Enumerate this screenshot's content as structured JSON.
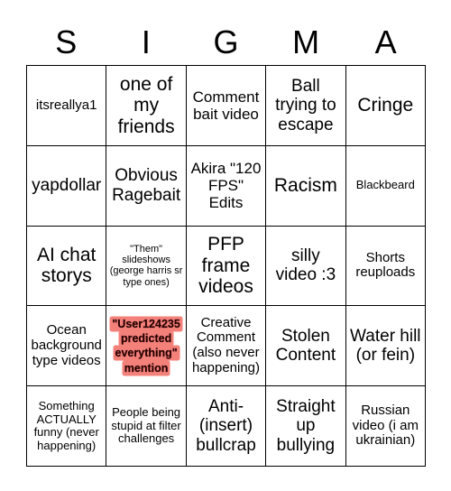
{
  "card": {
    "title": "SIGMA",
    "header_letters": [
      "S",
      "I",
      "G",
      "M",
      "A"
    ],
    "colors": {
      "grid_line": "#000000",
      "text": "#000000",
      "background": "#ffffff",
      "marked_highlight": "#f4807a",
      "marked_text": "#2a0000"
    },
    "rows": [
      [
        {
          "text": "itsreallya1",
          "size": "md",
          "marked": false
        },
        {
          "text": "one of my friends",
          "size": "xxl",
          "marked": false
        },
        {
          "text": "Comment bait video",
          "size": "lg",
          "marked": false
        },
        {
          "text": "Ball trying to escape",
          "size": "xl",
          "marked": false
        },
        {
          "text": "Cringe",
          "size": "xxl",
          "marked": false
        }
      ],
      [
        {
          "text": "yapdollar",
          "size": "xl",
          "marked": false
        },
        {
          "text": "Obvious Ragebait",
          "size": "xl",
          "marked": false
        },
        {
          "text": "Akira \"120 FPS\" Edits",
          "size": "lg",
          "marked": false
        },
        {
          "text": "Racism",
          "size": "xxl",
          "marked": false
        },
        {
          "text": "Blackbeard",
          "size": "sm",
          "marked": false
        }
      ],
      [
        {
          "text": "AI chat storys",
          "size": "xxl",
          "marked": false
        },
        {
          "text": "\"Them\" slideshows (george harris sr type ones)",
          "size": "xs",
          "marked": false
        },
        {
          "text": "PFP frame videos",
          "size": "xxl",
          "marked": false
        },
        {
          "text": "silly video :3",
          "size": "xl",
          "marked": false
        },
        {
          "text": "Shorts reuploads",
          "size": "md",
          "marked": false
        }
      ],
      [
        {
          "text": "Ocean background type videos",
          "size": "md",
          "marked": false
        },
        {
          "text": "\"User124235 predicted everything\" mention",
          "size": "xs",
          "marked": true
        },
        {
          "text": "Creative Comment (also never happening)",
          "size": "md",
          "marked": false
        },
        {
          "text": "Stolen Content",
          "size": "xl",
          "marked": false
        },
        {
          "text": "Water hill (or fein)",
          "size": "xl",
          "marked": false
        }
      ],
      [
        {
          "text": "Something ACTUALLY funny (never happening)",
          "size": "sm",
          "marked": false
        },
        {
          "text": "People being stupid at filter challenges",
          "size": "sm",
          "marked": false
        },
        {
          "text": "Anti-(insert) bullcrap",
          "size": "xl",
          "marked": false
        },
        {
          "text": "Straight up bullying",
          "size": "xl",
          "marked": false
        },
        {
          "text": "Russian video (i am ukrainian)",
          "size": "md",
          "marked": false
        }
      ]
    ]
  }
}
